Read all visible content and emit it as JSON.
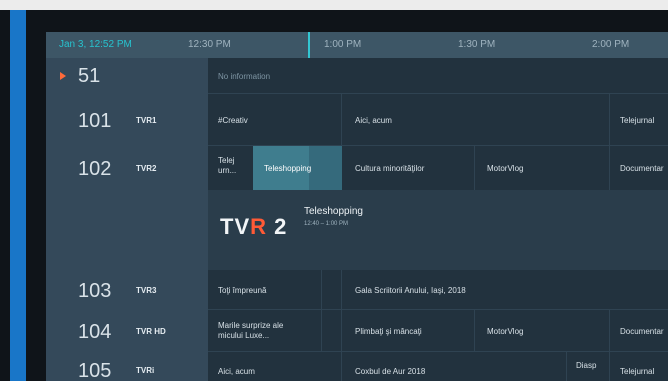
{
  "timebar": {
    "date": "Jan 3, 12:52 PM",
    "ticks": [
      "12:30 PM",
      "1:00 PM",
      "1:30 PM",
      "2:00 PM"
    ]
  },
  "channels": [
    {
      "number": "51",
      "logo": "",
      "programs": [
        {
          "title": "No information"
        }
      ]
    },
    {
      "number": "101",
      "logo": "TVR1",
      "programs": [
        {
          "title": "#Creativ"
        },
        {
          "title": "Aici, acum"
        },
        {
          "title": "Telejurnal"
        }
      ]
    },
    {
      "number": "102",
      "logo": "TVR2",
      "programs": [
        {
          "title": "Telej urn..."
        },
        {
          "title": "Teleshopping"
        },
        {
          "title": "Cultura minorităţilor"
        },
        {
          "title": "MotorVlog"
        },
        {
          "title": "Documentar"
        }
      ]
    },
    {
      "number": "103",
      "logo": "TVR3",
      "programs": [
        {
          "title": "Toţi împreună"
        },
        {
          "title": "Gala Scriitorii Anului, Iaşi, 2018"
        }
      ]
    },
    {
      "number": "104",
      "logo": "TVR HD",
      "programs": [
        {
          "title": "Marile surprize ale micului Luxe..."
        },
        {
          "title": "Plimbaţi şi mâncaţi"
        },
        {
          "title": "MotorVlog"
        },
        {
          "title": "Documentar"
        }
      ]
    },
    {
      "number": "105",
      "logo": "TVRi",
      "programs": [
        {
          "title": "Aici, acum"
        },
        {
          "title": "Coxbul de Aur 2018"
        },
        {
          "title": "Diasp"
        },
        {
          "title": "Telejurnal"
        }
      ]
    }
  ],
  "details": {
    "logo_text": "TV",
    "logo_r": "R",
    "logo_num": "2",
    "title": "Teleshopping",
    "time": "12:40 – 1:00 PM"
  },
  "colors": {
    "accent": "#27c3cf",
    "live": "#ff6a3a",
    "brand_blue": "#1976c8"
  }
}
